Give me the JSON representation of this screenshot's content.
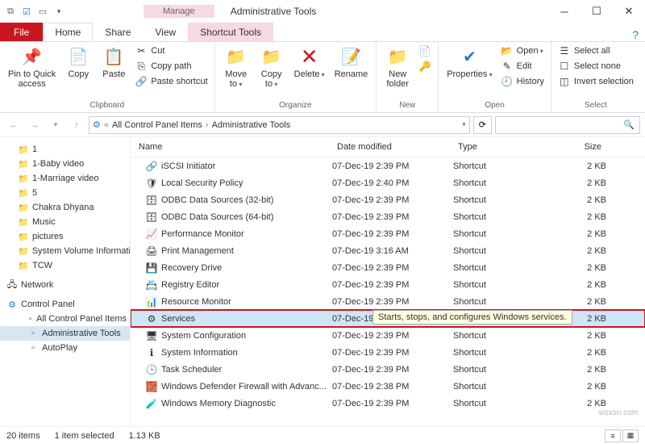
{
  "title": "Administrative Tools",
  "context_tab": "Manage",
  "tabs": {
    "file": "File",
    "home": "Home",
    "share": "Share",
    "view": "View",
    "shortcut": "Shortcut Tools"
  },
  "ribbon": {
    "clipboard": {
      "label": "Clipboard",
      "pin": "Pin to Quick\naccess",
      "copy": "Copy",
      "paste": "Paste",
      "cut": "Cut",
      "copypath": "Copy path",
      "pasteshortcut": "Paste shortcut"
    },
    "organize": {
      "label": "Organize",
      "move": "Move\nto",
      "copyto": "Copy\nto",
      "delete": "Delete",
      "rename": "Rename"
    },
    "new": {
      "label": "New",
      "newfolder": "New\nfolder"
    },
    "open": {
      "label": "Open",
      "properties": "Properties",
      "open": "Open",
      "edit": "Edit",
      "history": "History"
    },
    "select": {
      "label": "Select",
      "all": "Select all",
      "none": "Select none",
      "invert": "Invert selection"
    }
  },
  "breadcrumb": {
    "a": "All Control Panel Items",
    "b": "Administrative Tools"
  },
  "tree": {
    "folders": [
      "1",
      "1-Baby video",
      "1-Marriage video",
      "5",
      "Chakra Dhyana",
      "Music",
      "pictures",
      "System Volume Information",
      "TCW"
    ],
    "network": "Network",
    "cp": "Control Panel",
    "cp_items": [
      "All Control Panel Items",
      "Administrative Tools",
      "AutoPlay"
    ]
  },
  "columns": {
    "name": "Name",
    "date": "Date modified",
    "type": "Type",
    "size": "Size"
  },
  "rows": [
    {
      "name": "iSCSI Initiator",
      "date": "07-Dec-19 2:39 PM",
      "type": "Shortcut",
      "size": "2 KB",
      "ic": "🔗"
    },
    {
      "name": "Local Security Policy",
      "date": "07-Dec-19 2:40 PM",
      "type": "Shortcut",
      "size": "2 KB",
      "ic": "🛡"
    },
    {
      "name": "ODBC Data Sources (32-bit)",
      "date": "07-Dec-19 2:39 PM",
      "type": "Shortcut",
      "size": "2 KB",
      "ic": "🗄"
    },
    {
      "name": "ODBC Data Sources (64-bit)",
      "date": "07-Dec-19 2:39 PM",
      "type": "Shortcut",
      "size": "2 KB",
      "ic": "🗄"
    },
    {
      "name": "Performance Monitor",
      "date": "07-Dec-19 2:39 PM",
      "type": "Shortcut",
      "size": "2 KB",
      "ic": "📈"
    },
    {
      "name": "Print Management",
      "date": "07-Dec-19 3:16 AM",
      "type": "Shortcut",
      "size": "2 KB",
      "ic": "🖨"
    },
    {
      "name": "Recovery Drive",
      "date": "07-Dec-19 2:39 PM",
      "type": "Shortcut",
      "size": "2 KB",
      "ic": "💾"
    },
    {
      "name": "Registry Editor",
      "date": "07-Dec-19 2:39 PM",
      "type": "Shortcut",
      "size": "2 KB",
      "ic": "📇"
    },
    {
      "name": "Resource Monitor",
      "date": "07-Dec-19 2:39 PM",
      "type": "Shortcut",
      "size": "2 KB",
      "ic": "📊"
    },
    {
      "name": "Services",
      "date": "07-Dec-19 2:39 PM",
      "type": "Shortcut",
      "size": "2 KB",
      "ic": "⚙",
      "sel": true,
      "tooltip": "Starts, stops, and configures Windows services."
    },
    {
      "name": "System Configuration",
      "date": "07-Dec-19 2:39 PM",
      "type": "Shortcut",
      "size": "2 KB",
      "ic": "🖥"
    },
    {
      "name": "System Information",
      "date": "07-Dec-19 2:39 PM",
      "type": "Shortcut",
      "size": "2 KB",
      "ic": "ℹ"
    },
    {
      "name": "Task Scheduler",
      "date": "07-Dec-19 2:39 PM",
      "type": "Shortcut",
      "size": "2 KB",
      "ic": "🕒"
    },
    {
      "name": "Windows Defender Firewall with Advanc...",
      "date": "07-Dec-19 2:38 PM",
      "type": "Shortcut",
      "size": "2 KB",
      "ic": "🧱"
    },
    {
      "name": "Windows Memory Diagnostic",
      "date": "07-Dec-19 2:39 PM",
      "type": "Shortcut",
      "size": "2 KB",
      "ic": "🧪"
    }
  ],
  "status": {
    "count": "20 items",
    "selected": "1 item selected",
    "size": "1.13 KB"
  },
  "watermark": "wsxsn.com"
}
